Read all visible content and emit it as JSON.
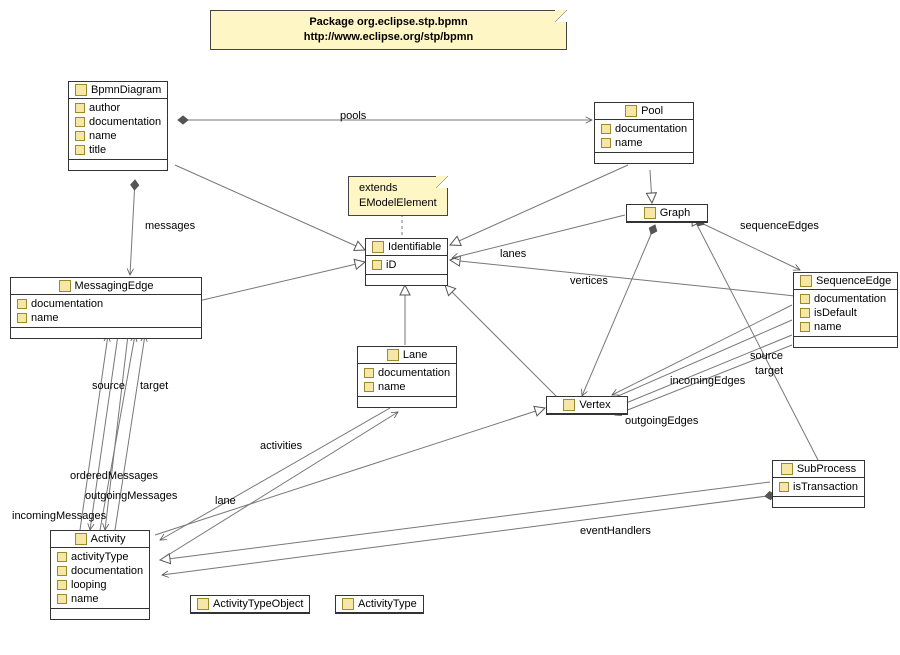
{
  "package_note": {
    "line1": "Package org.eclipse.stp.bpmn",
    "line2": "http://www.eclipse.org/stp/bpmn"
  },
  "extends_note": {
    "line1": "extends",
    "line2": "EModelElement"
  },
  "classes": {
    "BpmnDiagram": {
      "name": "BpmnDiagram",
      "attrs": [
        "author",
        "documentation",
        "name",
        "title"
      ]
    },
    "Pool": {
      "name": "Pool",
      "attrs": [
        "documentation",
        "name"
      ]
    },
    "MessagingEdge": {
      "name": "MessagingEdge",
      "attrs": [
        "documentation",
        "name"
      ]
    },
    "Identifiable": {
      "name": "Identifiable",
      "attrs": [
        "iD"
      ]
    },
    "Graph": {
      "name": "Graph",
      "attrs": []
    },
    "SequenceEdge": {
      "name": "SequenceEdge",
      "attrs": [
        "documentation",
        "isDefault",
        "name"
      ]
    },
    "Lane": {
      "name": "Lane",
      "attrs": [
        "documentation",
        "name"
      ]
    },
    "Vertex": {
      "name": "Vertex",
      "attrs": []
    },
    "SubProcess": {
      "name": "SubProcess",
      "attrs": [
        "isTransaction"
      ]
    },
    "Activity": {
      "name": "Activity",
      "attrs": [
        "activityType",
        "documentation",
        "looping",
        "name"
      ]
    },
    "ActivityTypeObject": {
      "name": "ActivityTypeObject",
      "attrs": []
    },
    "ActivityType": {
      "name": "ActivityType",
      "attrs": []
    }
  },
  "assoc_labels": {
    "pools": "pools",
    "messages": "messages",
    "lanes": "lanes",
    "vertices": "vertices",
    "sequenceEdges": "sequenceEdges",
    "source": "source",
    "target": "target",
    "incomingEdges": "incomingEdges",
    "outgoingEdges": "outgoingEdges",
    "activities": "activities",
    "lane": "lane",
    "orderedMessages": "orderedMessages",
    "outgoingMessages": "outgoingMessages",
    "incomingMessages": "incomingMessages",
    "eventHandlers": "eventHandlers",
    "source2": "source",
    "target2": "target"
  },
  "chart_data": {
    "type": "diagram",
    "title": "Package org.eclipse.stp.bpmn",
    "subtitle": "http://www.eclipse.org/stp/bpmn",
    "notation": "UML Class Diagram",
    "nodes": [
      {
        "id": "BpmnDiagram",
        "kind": "class",
        "attributes": [
          "author",
          "documentation",
          "name",
          "title"
        ]
      },
      {
        "id": "Pool",
        "kind": "class",
        "attributes": [
          "documentation",
          "name"
        ]
      },
      {
        "id": "MessagingEdge",
        "kind": "class",
        "attributes": [
          "documentation",
          "name"
        ]
      },
      {
        "id": "Identifiable",
        "kind": "class",
        "attributes": [
          "iD"
        ],
        "note": "extends EModelElement"
      },
      {
        "id": "Graph",
        "kind": "class",
        "attributes": []
      },
      {
        "id": "SequenceEdge",
        "kind": "class",
        "attributes": [
          "documentation",
          "isDefault",
          "name"
        ]
      },
      {
        "id": "Lane",
        "kind": "class",
        "attributes": [
          "documentation",
          "name"
        ]
      },
      {
        "id": "Vertex",
        "kind": "class",
        "attributes": []
      },
      {
        "id": "SubProcess",
        "kind": "class",
        "attributes": [
          "isTransaction"
        ]
      },
      {
        "id": "Activity",
        "kind": "class",
        "attributes": [
          "activityType",
          "documentation",
          "looping",
          "name"
        ]
      },
      {
        "id": "ActivityTypeObject",
        "kind": "datatype",
        "attributes": []
      },
      {
        "id": "ActivityType",
        "kind": "datatype",
        "attributes": []
      }
    ],
    "edges": [
      {
        "from": "BpmnDiagram",
        "to": "Identifiable",
        "kind": "generalization"
      },
      {
        "from": "Pool",
        "to": "Identifiable",
        "kind": "generalization"
      },
      {
        "from": "Pool",
        "to": "Graph",
        "kind": "generalization"
      },
      {
        "from": "MessagingEdge",
        "to": "Identifiable",
        "kind": "generalization"
      },
      {
        "from": "SequenceEdge",
        "to": "Identifiable",
        "kind": "generalization"
      },
      {
        "from": "Lane",
        "to": "Identifiable",
        "kind": "generalization"
      },
      {
        "from": "Vertex",
        "to": "Identifiable",
        "kind": "generalization"
      },
      {
        "from": "Activity",
        "to": "Vertex",
        "kind": "generalization"
      },
      {
        "from": "SubProcess",
        "to": "Activity",
        "kind": "generalization"
      },
      {
        "from": "SubProcess",
        "to": "Graph",
        "kind": "generalization"
      },
      {
        "from": "BpmnDiagram",
        "to": "Pool",
        "kind": "composition",
        "label": "pools"
      },
      {
        "from": "BpmnDiagram",
        "to": "MessagingEdge",
        "kind": "composition",
        "label": "messages"
      },
      {
        "from": "Graph",
        "to": "Lane",
        "kind": "association",
        "label": "lanes"
      },
      {
        "from": "Graph",
        "to": "Vertex",
        "kind": "composition",
        "label": "vertices"
      },
      {
        "from": "Graph",
        "to": "SequenceEdge",
        "kind": "composition",
        "label": "sequenceEdges"
      },
      {
        "from": "MessagingEdge",
        "to": "Activity",
        "kind": "association",
        "label": "source"
      },
      {
        "from": "MessagingEdge",
        "to": "Activity",
        "kind": "association",
        "label": "target"
      },
      {
        "from": "Activity",
        "to": "MessagingEdge",
        "kind": "association",
        "label": "orderedMessages"
      },
      {
        "from": "Activity",
        "to": "MessagingEdge",
        "kind": "association",
        "label": "outgoingMessages"
      },
      {
        "from": "Activity",
        "to": "MessagingEdge",
        "kind": "association",
        "label": "incomingMessages"
      },
      {
        "from": "Lane",
        "to": "Activity",
        "kind": "association",
        "label": "activities"
      },
      {
        "from": "Activity",
        "to": "Lane",
        "kind": "association",
        "label": "lane"
      },
      {
        "from": "SequenceEdge",
        "to": "Vertex",
        "kind": "association",
        "label": "source"
      },
      {
        "from": "SequenceEdge",
        "to": "Vertex",
        "kind": "association",
        "label": "target"
      },
      {
        "from": "Vertex",
        "to": "SequenceEdge",
        "kind": "association",
        "label": "incomingEdges"
      },
      {
        "from": "Vertex",
        "to": "SequenceEdge",
        "kind": "association",
        "label": "outgoingEdges"
      },
      {
        "from": "SubProcess",
        "to": "Activity",
        "kind": "composition",
        "label": "eventHandlers"
      }
    ]
  }
}
